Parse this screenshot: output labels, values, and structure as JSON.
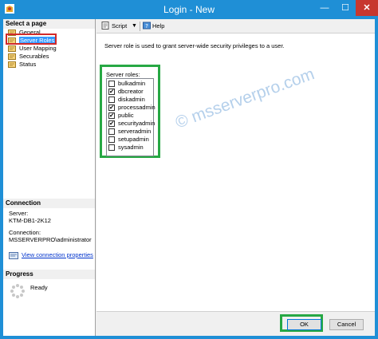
{
  "window": {
    "title": "Login - New",
    "minimize": "—",
    "maximize": "☐",
    "close": "✕"
  },
  "left_pane": {
    "select_page_header": "Select a page",
    "nav_items": [
      {
        "label": "General",
        "icon": "page-icon"
      },
      {
        "label": "Server Roles",
        "icon": "page-icon",
        "selected": true
      },
      {
        "label": "User Mapping",
        "icon": "page-icon"
      },
      {
        "label": "Securables",
        "icon": "page-icon"
      },
      {
        "label": "Status",
        "icon": "page-icon"
      }
    ],
    "connection_header": "Connection",
    "server_label": "Server:",
    "server_value": "KTM-DB1-2K12",
    "connection_label": "Connection:",
    "connection_value": "MSSERVERPRO\\administrator",
    "view_connection_link": "View connection properties",
    "progress_header": "Progress",
    "progress_status": "Ready"
  },
  "toolbar": {
    "script_label": "Script",
    "script_dropdown": "▼",
    "help_label": "Help"
  },
  "main": {
    "description": "Server role is used to grant server-wide security privileges to a user.",
    "roles_label": "Server roles:",
    "roles": [
      {
        "name": "bulkadmin",
        "checked": false
      },
      {
        "name": "dbcreator",
        "checked": true
      },
      {
        "name": "diskadmin",
        "checked": false
      },
      {
        "name": "processadmin",
        "checked": true
      },
      {
        "name": "public",
        "checked": true
      },
      {
        "name": "securityadmin",
        "checked": true
      },
      {
        "name": "serveradmin",
        "checked": false
      },
      {
        "name": "setupadmin",
        "checked": false
      },
      {
        "name": "sysadmin",
        "checked": false
      }
    ],
    "watermark": "© msserverpro.com"
  },
  "footer": {
    "ok_label": "OK",
    "cancel_label": "Cancel"
  },
  "colors": {
    "titlebar": "#1f8fd6",
    "selection": "#3399ff",
    "highlight_green": "#27a844",
    "highlight_red": "#d12a2a",
    "link": "#0033cc"
  }
}
